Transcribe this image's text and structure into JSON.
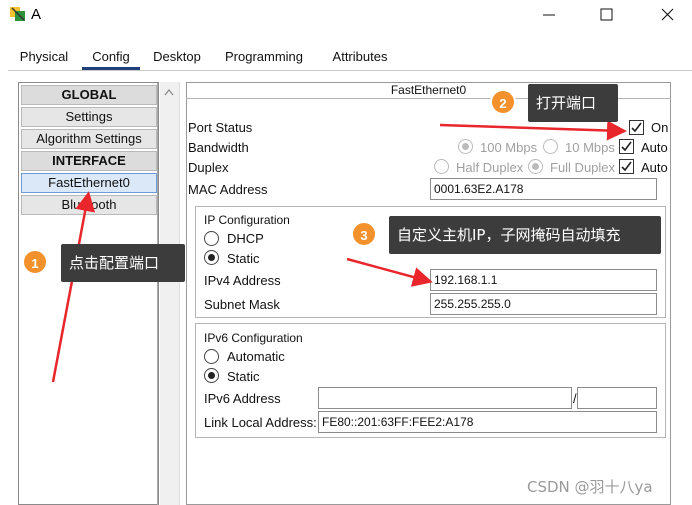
{
  "window": {
    "title": "A"
  },
  "tabs": [
    {
      "label": "Physical"
    },
    {
      "label": "Config"
    },
    {
      "label": "Desktop"
    },
    {
      "label": "Programming"
    },
    {
      "label": "Attributes"
    }
  ],
  "active_tab": "Config",
  "sidebar": {
    "items": [
      {
        "label": "GLOBAL",
        "type": "header"
      },
      {
        "label": "Settings",
        "type": "item"
      },
      {
        "label": "Algorithm Settings",
        "type": "item"
      },
      {
        "label": "INTERFACE",
        "type": "header"
      },
      {
        "label": "FastEthernet0",
        "type": "item",
        "selected": true
      },
      {
        "label": "Bluetooth",
        "type": "item"
      }
    ]
  },
  "panel": {
    "title": "FastEthernet0",
    "port_status": {
      "label": "Port Status",
      "checked": true,
      "value_label": "On"
    },
    "bandwidth": {
      "label": "Bandwidth",
      "option_100": "100 Mbps",
      "option_10": "10 Mbps",
      "auto_label": "Auto",
      "auto_checked": true
    },
    "duplex": {
      "label": "Duplex",
      "option_half": "Half Duplex",
      "option_full": "Full Duplex",
      "auto_label": "Auto",
      "auto_checked": true
    },
    "mac": {
      "label": "MAC Address",
      "value": "0001.63E2.A178"
    },
    "ipv4": {
      "group_label": "IP Configuration",
      "dhcp_label": "DHCP",
      "static_label": "Static",
      "mode": "Static",
      "address_label": "IPv4 Address",
      "address_value": "192.168.1.1",
      "mask_label": "Subnet Mask",
      "mask_value": "255.255.255.0"
    },
    "ipv6": {
      "group_label": "IPv6 Configuration",
      "automatic_label": "Automatic",
      "static_label": "Static",
      "mode": "Static",
      "address_label": "IPv6 Address",
      "address_value": "",
      "prefix_separator": "/",
      "prefix_value": "",
      "link_local_label": "Link Local Address:",
      "link_local_value": "FE80::201:63FF:FEE2:A178"
    }
  },
  "annotations": [
    {
      "number": "1",
      "text": "点击配置端口"
    },
    {
      "number": "2",
      "text": "打开端口"
    },
    {
      "number": "3",
      "text": "自定义主机IP，子网掩码自动填充"
    }
  ],
  "watermark": "CSDN @羽十八ya",
  "colors": {
    "badge": "#f3922c",
    "callout_bg": "#3c3c3c",
    "arrow": "#e8262b",
    "active_tab_underline": "#1f3f7a"
  }
}
